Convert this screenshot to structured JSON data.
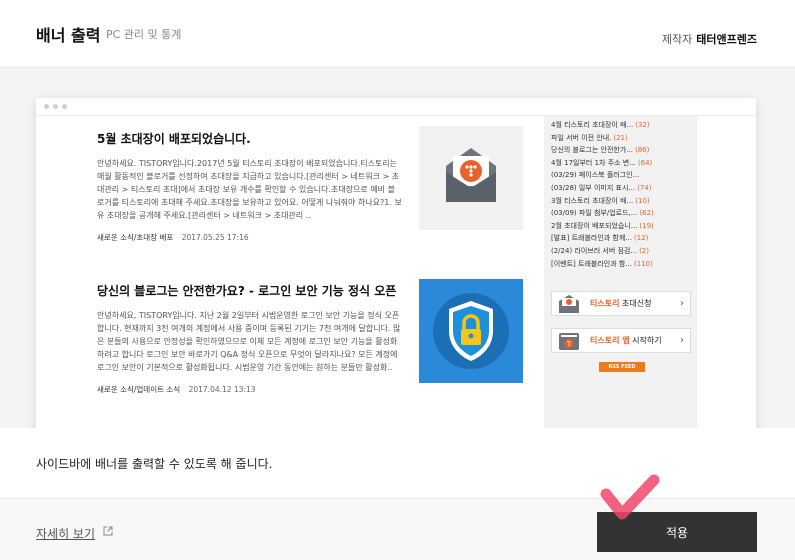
{
  "header": {
    "title": "배너 출력",
    "subtitle": "PC 관리 및 통계",
    "maker_label": "제작자",
    "maker_name": "태터앤프렌즈"
  },
  "preview": {
    "posts": [
      {
        "title": "5월 초대장이 배포되었습니다.",
        "body": "안녕하세요. TISTORY입니다.2017년 5월 티스토리 초대장이 배포되었습니다.티스토리는 매월 활동적인 블로거를 선정하여 초대장을 지급하고 있습니다.[관리센터 > 네트워크 > 초대관리 > 티스토리 초대]에서 초대장 보유 개수를 확인할 수 있습니다.초대장으로 예비 블로거를 티스토리에 초대해 주세요.초대장을 보유하고 있어요. 어떻게 나눠줘야 하나요?1. 보유 초대장을 공개해 주세요.[관리센터 > 네트워크 > 초대관리 ..",
        "category": "새로운 소식/초대장 배포",
        "date": "2017.05.25 17:16"
      },
      {
        "title": "당신의 블로그는 안전한가요? - 로그인 보안 기능 정식 오픈",
        "body": "안녕하세요, TISTORY입니다. 지난 2월 2일부터 시범운영한 로그인 보안 기능을 정식 오픈합니다. 현재까지 3천 여개의 계정에서 사용 중이며 등록된 기기는 7천 여개에 달합니다. 많은 분들의 사용으로 안정성을 확인하였으므로 이제 모든 계정에 로그인 보안 기능을 활성화하려고 합니다 로그인 보안 바로가기 Q&A 정식 오픈으로 무엇이 달라지나요? 모든 계정에 로그인 보안이 기본적으로 활성화됩니다. 시범운영 기간 동안에는 원하는 분들만 활성화..",
        "category": "새로운 소식/업데이트 소식",
        "date": "2017.04.12 13:13"
      }
    ],
    "sidebar_items": [
      {
        "text": "4월 티스토리 초대장이 배...",
        "count": "(32)"
      },
      {
        "text": "파일 서버 이전 안내.",
        "count": "(21)"
      },
      {
        "text": "당신의 블로그는 안전한가...",
        "count": "(86)"
      },
      {
        "text": "4월 17일부터 1차 주소 변...",
        "count": "(64)"
      },
      {
        "text": "(03/29) 페이스북 플러그인...",
        "count": ""
      },
      {
        "text": "(03/28) 일부 이미지 표시...",
        "count": "(74)"
      },
      {
        "text": "3월 티스토리 초대장이 배...",
        "count": "(10)"
      },
      {
        "text": "(03/09) 파일 첨부/업로드,...",
        "count": "(62)"
      },
      {
        "text": "2월 초대장이 배포되었습니...",
        "count": "(19)"
      },
      {
        "text": "[발표] 트래블라인과 함께...",
        "count": "(12)"
      },
      {
        "text": "(2/24) 라이브러 서버 점검...",
        "count": "(2)"
      },
      {
        "text": "[이벤트] 트래블라인과 함...",
        "count": "(110)"
      }
    ],
    "banners": [
      {
        "brand": "티스토리",
        "action": "초대신청"
      },
      {
        "brand": "티스토리 앱",
        "action": "시작하기"
      }
    ],
    "rss_label": "RSS FEED"
  },
  "description": "사이드바에 배너를 출력할 수 있도록 해 줍니다.",
  "footer": {
    "more_label": "자세히 보기",
    "apply_label": "적용"
  },
  "colors": {
    "accent_orange": "#e8632b",
    "apply_button": "#333333",
    "check_mark": "#f0466b"
  }
}
